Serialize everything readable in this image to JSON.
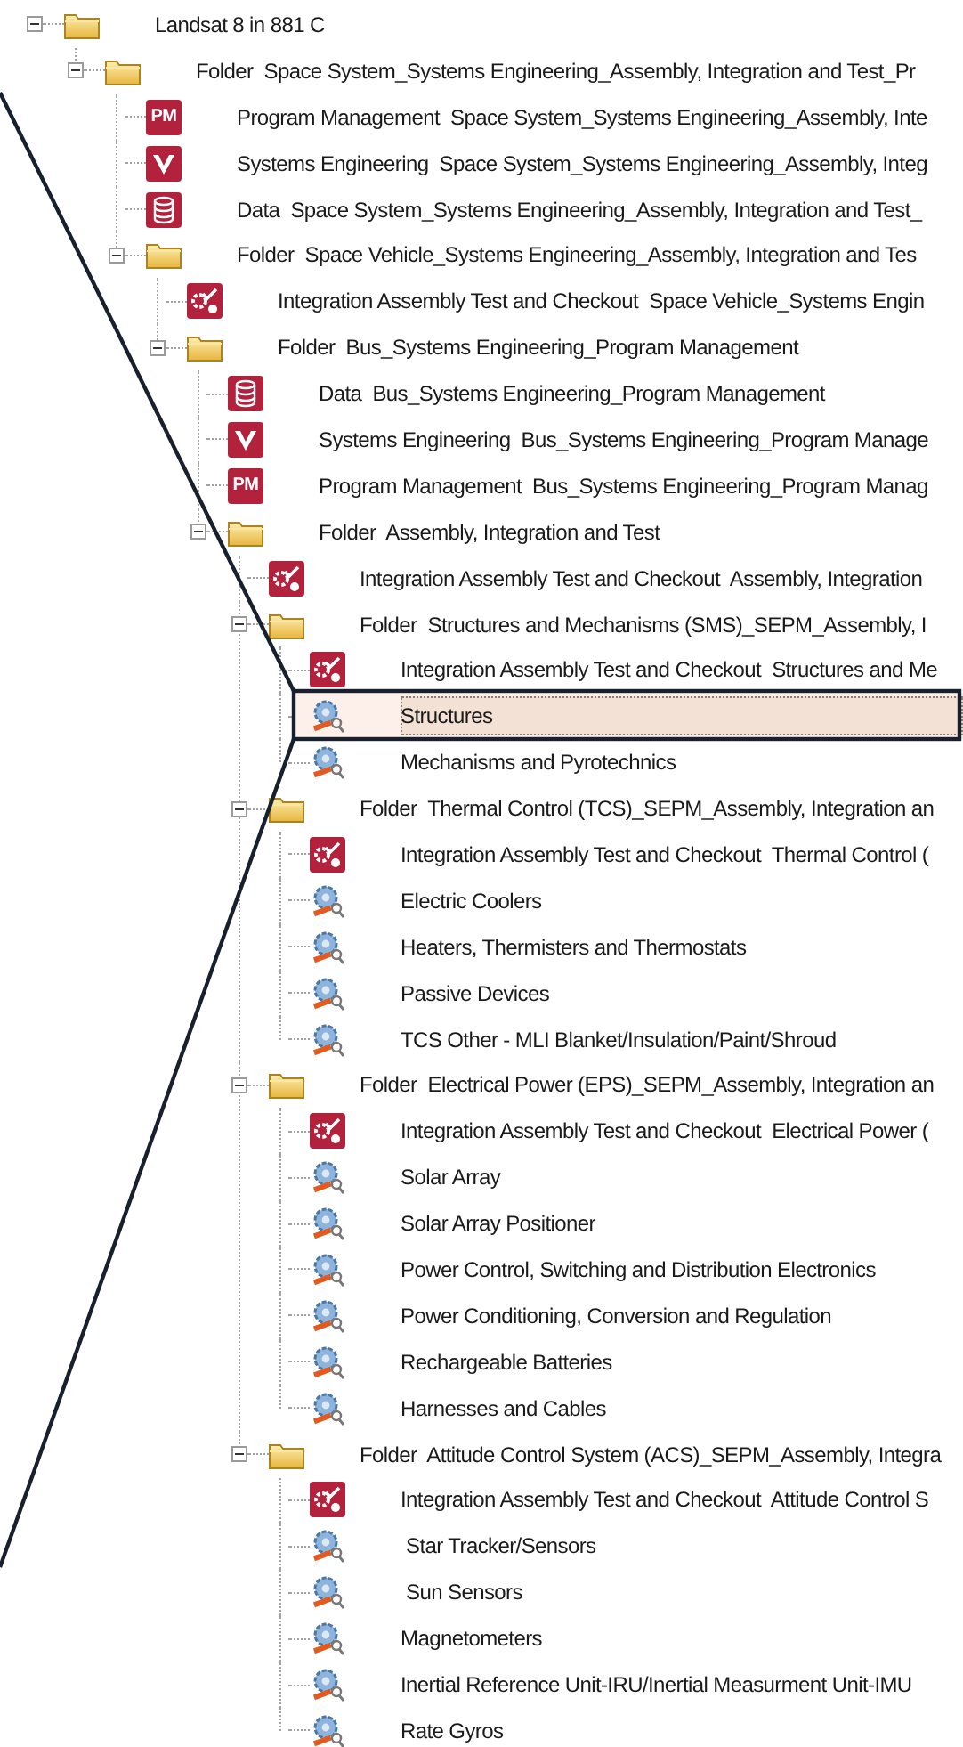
{
  "tree": {
    "items": [
      {
        "kind": "folder",
        "label": "Landsat 8 in 881 C",
        "expanded": true,
        "selected": false,
        "children": [
          {
            "kind": "folder",
            "label": "Folder  Space System_Systems Engineering_Assembly, Integration and Test_Pr",
            "expanded": true,
            "selected": false,
            "children": [
              {
                "kind": "pm",
                "badge": "PM",
                "label": "Program Management  Space System_Systems Engineering_Assembly, Inte",
                "selected": false
              },
              {
                "kind": "se",
                "label": "Systems Engineering  Space System_Systems Engineering_Assembly, Integ",
                "selected": false
              },
              {
                "kind": "data",
                "label": "Data  Space System_Systems Engineering_Assembly, Integration and Test_",
                "selected": false
              },
              {
                "kind": "folder",
                "label": "Folder  Space Vehicle_Systems Engineering_Assembly, Integration and Tes",
                "expanded": true,
                "selected": false,
                "children": [
                  {
                    "kind": "iatc",
                    "label": "Integration Assembly Test and Checkout  Space Vehicle_Systems Engin",
                    "selected": false
                  },
                  {
                    "kind": "folder",
                    "label": "Folder  Bus_Systems Engineering_Program Management",
                    "expanded": true,
                    "selected": false,
                    "children": [
                      {
                        "kind": "data",
                        "label": "Data  Bus_Systems Engineering_Program Management",
                        "selected": false
                      },
                      {
                        "kind": "se",
                        "label": "Systems Engineering  Bus_Systems Engineering_Program Manage",
                        "selected": false
                      },
                      {
                        "kind": "pm",
                        "badge": "PM",
                        "label": "Program Management  Bus_Systems Engineering_Program Manag",
                        "selected": false
                      },
                      {
                        "kind": "folder",
                        "label": "Folder  Assembly, Integration and Test",
                        "expanded": true,
                        "selected": false,
                        "children": [
                          {
                            "kind": "iatc",
                            "label": "Integration Assembly Test and Checkout  Assembly, Integration",
                            "selected": false
                          },
                          {
                            "kind": "folder",
                            "label": "Folder  Structures and Mechanisms (SMS)_SEPM_Assembly, I",
                            "expanded": true,
                            "selected": false,
                            "children": [
                              {
                                "kind": "iatc",
                                "label": "Integration Assembly Test and Checkout  Structures and Me",
                                "selected": false
                              },
                              {
                                "kind": "component",
                                "label": "Structures",
                                "selected": true
                              },
                              {
                                "kind": "component",
                                "label": "Mechanisms and Pyrotechnics",
                                "selected": false
                              }
                            ]
                          },
                          {
                            "kind": "folder",
                            "label": "Folder  Thermal Control (TCS)_SEPM_Assembly, Integration an",
                            "expanded": true,
                            "selected": false,
                            "children": [
                              {
                                "kind": "iatc",
                                "label": "Integration Assembly Test and Checkout  Thermal Control (",
                                "selected": false
                              },
                              {
                                "kind": "component",
                                "label": "Electric Coolers",
                                "selected": false
                              },
                              {
                                "kind": "component",
                                "label": "Heaters, Thermisters and Thermostats",
                                "selected": false
                              },
                              {
                                "kind": "component",
                                "label": "Passive Devices",
                                "selected": false
                              },
                              {
                                "kind": "component",
                                "label": "TCS Other - MLI Blanket/Insulation/Paint/Shroud",
                                "selected": false
                              }
                            ]
                          },
                          {
                            "kind": "folder",
                            "label": "Folder  Electrical Power (EPS)_SEPM_Assembly, Integration an",
                            "expanded": true,
                            "selected": false,
                            "children": [
                              {
                                "kind": "iatc",
                                "label": "Integration Assembly Test and Checkout  Electrical Power (",
                                "selected": false
                              },
                              {
                                "kind": "component",
                                "label": "Solar Array",
                                "selected": false
                              },
                              {
                                "kind": "component",
                                "label": "Solar Array Positioner",
                                "selected": false
                              },
                              {
                                "kind": "component",
                                "label": "Power Control, Switching and Distribution Electronics",
                                "selected": false
                              },
                              {
                                "kind": "component",
                                "label": "Power Conditioning, Conversion and Regulation",
                                "selected": false
                              },
                              {
                                "kind": "component",
                                "label": "Rechargeable Batteries",
                                "selected": false
                              },
                              {
                                "kind": "component",
                                "label": "Harnesses and Cables",
                                "selected": false
                              }
                            ]
                          },
                          {
                            "kind": "folder",
                            "label": "Folder  Attitude Control System (ACS)_SEPM_Assembly, Integra",
                            "expanded": true,
                            "selected": false,
                            "children": [
                              {
                                "kind": "iatc",
                                "label": "Integration Assembly Test and Checkout  Attitude Control S",
                                "selected": false
                              },
                              {
                                "kind": "component",
                                "label": " Star Tracker/Sensors",
                                "selected": false
                              },
                              {
                                "kind": "component",
                                "label": " Sun Sensors",
                                "selected": false
                              },
                              {
                                "kind": "component",
                                "label": "Magnetometers",
                                "selected": false
                              },
                              {
                                "kind": "component",
                                "label": "Inertial Reference Unit-IRU/Inertial Measurment Unit-IMU",
                                "selected": false
                              },
                              {
                                "kind": "component",
                                "label": "Rate Gyros",
                                "selected": false
                              }
                            ]
                          }
                        ]
                      }
                    ]
                  }
                ]
              }
            ]
          }
        ]
      }
    ]
  }
}
